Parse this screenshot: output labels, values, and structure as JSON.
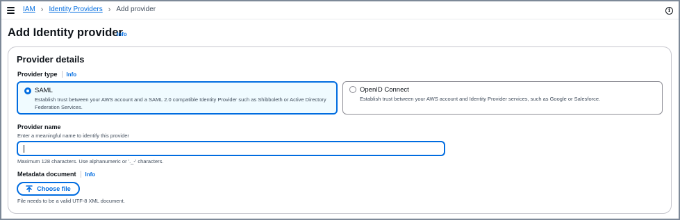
{
  "breadcrumb": {
    "items": [
      "IAM",
      "Identity Providers"
    ],
    "current": "Add provider"
  },
  "header": {
    "title": "Add Identity provider",
    "info": "Info"
  },
  "provider_details": {
    "title": "Provider details",
    "type_label": "Provider type",
    "type_info": "Info",
    "options": [
      {
        "title": "SAML",
        "description": "Establish trust between your AWS account and a SAML 2.0 compatible Identity Provider such as Shibboleth or Active Directory Federation Services.",
        "selected": true
      },
      {
        "title": "OpenID Connect",
        "description": "Establish trust between your AWS account and Identity Provider services, such as Google or Salesforce.",
        "selected": false
      }
    ],
    "name_label": "Provider name",
    "name_description": "Enter a meaningful name to identify this provider",
    "name_value": "",
    "name_constraint": "Maximum 128 characters. Use alphanumeric or '._-' characters.",
    "metadata_label": "Metadata document",
    "metadata_info": "Info",
    "choose_file_label": "Choose file",
    "metadata_constraint": "File needs to be a valid UTF-8 XML document."
  },
  "icons": {
    "menu": "hamburger-menu-icon",
    "info": "info-circle-icon",
    "upload": "upload-arrow-icon",
    "separator": "chevron-right-icon"
  },
  "colors": {
    "accent": "#006ce0",
    "selected_tile_bg": "#f0fbff",
    "text": "#0f141a",
    "secondary_text": "#414d5c"
  }
}
